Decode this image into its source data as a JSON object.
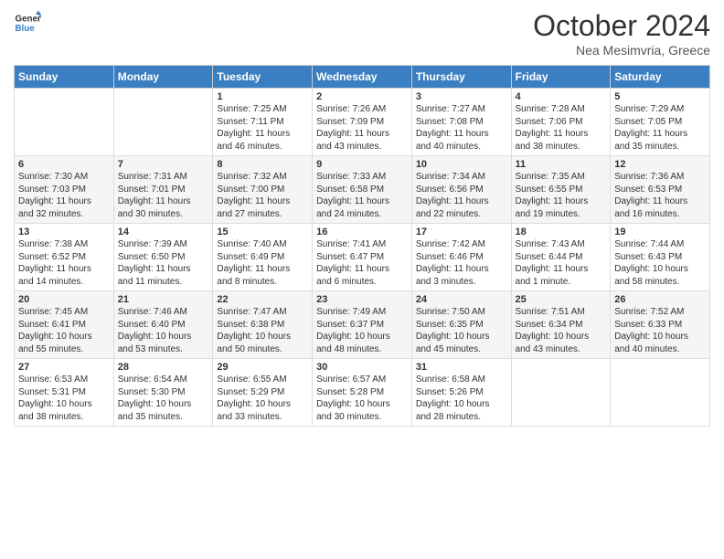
{
  "header": {
    "logo_line1": "General",
    "logo_line2": "Blue",
    "title": "October 2024",
    "subtitle": "Nea Mesimvria, Greece"
  },
  "days_of_week": [
    "Sunday",
    "Monday",
    "Tuesday",
    "Wednesday",
    "Thursday",
    "Friday",
    "Saturday"
  ],
  "weeks": [
    [
      {
        "day": "",
        "info": ""
      },
      {
        "day": "",
        "info": ""
      },
      {
        "day": "1",
        "info": "Sunrise: 7:25 AM\nSunset: 7:11 PM\nDaylight: 11 hours\nand 46 minutes."
      },
      {
        "day": "2",
        "info": "Sunrise: 7:26 AM\nSunset: 7:09 PM\nDaylight: 11 hours\nand 43 minutes."
      },
      {
        "day": "3",
        "info": "Sunrise: 7:27 AM\nSunset: 7:08 PM\nDaylight: 11 hours\nand 40 minutes."
      },
      {
        "day": "4",
        "info": "Sunrise: 7:28 AM\nSunset: 7:06 PM\nDaylight: 11 hours\nand 38 minutes."
      },
      {
        "day": "5",
        "info": "Sunrise: 7:29 AM\nSunset: 7:05 PM\nDaylight: 11 hours\nand 35 minutes."
      }
    ],
    [
      {
        "day": "6",
        "info": "Sunrise: 7:30 AM\nSunset: 7:03 PM\nDaylight: 11 hours\nand 32 minutes."
      },
      {
        "day": "7",
        "info": "Sunrise: 7:31 AM\nSunset: 7:01 PM\nDaylight: 11 hours\nand 30 minutes."
      },
      {
        "day": "8",
        "info": "Sunrise: 7:32 AM\nSunset: 7:00 PM\nDaylight: 11 hours\nand 27 minutes."
      },
      {
        "day": "9",
        "info": "Sunrise: 7:33 AM\nSunset: 6:58 PM\nDaylight: 11 hours\nand 24 minutes."
      },
      {
        "day": "10",
        "info": "Sunrise: 7:34 AM\nSunset: 6:56 PM\nDaylight: 11 hours\nand 22 minutes."
      },
      {
        "day": "11",
        "info": "Sunrise: 7:35 AM\nSunset: 6:55 PM\nDaylight: 11 hours\nand 19 minutes."
      },
      {
        "day": "12",
        "info": "Sunrise: 7:36 AM\nSunset: 6:53 PM\nDaylight: 11 hours\nand 16 minutes."
      }
    ],
    [
      {
        "day": "13",
        "info": "Sunrise: 7:38 AM\nSunset: 6:52 PM\nDaylight: 11 hours\nand 14 minutes."
      },
      {
        "day": "14",
        "info": "Sunrise: 7:39 AM\nSunset: 6:50 PM\nDaylight: 11 hours\nand 11 minutes."
      },
      {
        "day": "15",
        "info": "Sunrise: 7:40 AM\nSunset: 6:49 PM\nDaylight: 11 hours\nand 8 minutes."
      },
      {
        "day": "16",
        "info": "Sunrise: 7:41 AM\nSunset: 6:47 PM\nDaylight: 11 hours\nand 6 minutes."
      },
      {
        "day": "17",
        "info": "Sunrise: 7:42 AM\nSunset: 6:46 PM\nDaylight: 11 hours\nand 3 minutes."
      },
      {
        "day": "18",
        "info": "Sunrise: 7:43 AM\nSunset: 6:44 PM\nDaylight: 11 hours\nand 1 minute."
      },
      {
        "day": "19",
        "info": "Sunrise: 7:44 AM\nSunset: 6:43 PM\nDaylight: 10 hours\nand 58 minutes."
      }
    ],
    [
      {
        "day": "20",
        "info": "Sunrise: 7:45 AM\nSunset: 6:41 PM\nDaylight: 10 hours\nand 55 minutes."
      },
      {
        "day": "21",
        "info": "Sunrise: 7:46 AM\nSunset: 6:40 PM\nDaylight: 10 hours\nand 53 minutes."
      },
      {
        "day": "22",
        "info": "Sunrise: 7:47 AM\nSunset: 6:38 PM\nDaylight: 10 hours\nand 50 minutes."
      },
      {
        "day": "23",
        "info": "Sunrise: 7:49 AM\nSunset: 6:37 PM\nDaylight: 10 hours\nand 48 minutes."
      },
      {
        "day": "24",
        "info": "Sunrise: 7:50 AM\nSunset: 6:35 PM\nDaylight: 10 hours\nand 45 minutes."
      },
      {
        "day": "25",
        "info": "Sunrise: 7:51 AM\nSunset: 6:34 PM\nDaylight: 10 hours\nand 43 minutes."
      },
      {
        "day": "26",
        "info": "Sunrise: 7:52 AM\nSunset: 6:33 PM\nDaylight: 10 hours\nand 40 minutes."
      }
    ],
    [
      {
        "day": "27",
        "info": "Sunrise: 6:53 AM\nSunset: 5:31 PM\nDaylight: 10 hours\nand 38 minutes."
      },
      {
        "day": "28",
        "info": "Sunrise: 6:54 AM\nSunset: 5:30 PM\nDaylight: 10 hours\nand 35 minutes."
      },
      {
        "day": "29",
        "info": "Sunrise: 6:55 AM\nSunset: 5:29 PM\nDaylight: 10 hours\nand 33 minutes."
      },
      {
        "day": "30",
        "info": "Sunrise: 6:57 AM\nSunset: 5:28 PM\nDaylight: 10 hours\nand 30 minutes."
      },
      {
        "day": "31",
        "info": "Sunrise: 6:58 AM\nSunset: 5:26 PM\nDaylight: 10 hours\nand 28 minutes."
      },
      {
        "day": "",
        "info": ""
      },
      {
        "day": "",
        "info": ""
      }
    ]
  ]
}
